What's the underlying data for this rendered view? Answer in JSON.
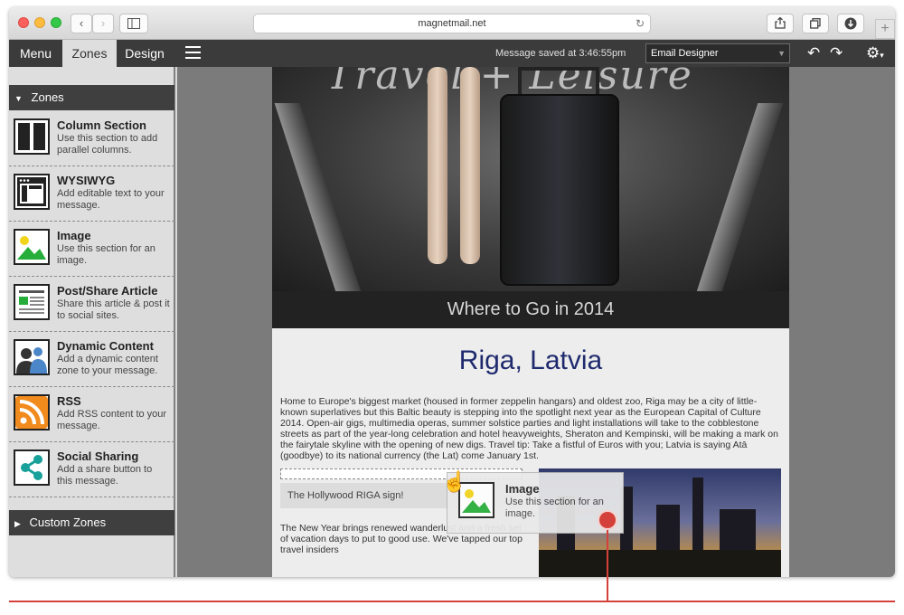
{
  "browser": {
    "url": "magnetmail.net",
    "nav_back": "‹",
    "nav_forward": "›",
    "new_tab": "+"
  },
  "toolbar": {
    "tabs": [
      {
        "label": "Menu",
        "active": false
      },
      {
        "label": "Zones",
        "active": true
      },
      {
        "label": "Design",
        "active": false
      }
    ],
    "save_status": "Message saved at 3:46:55pm",
    "mode_select": "Email Designer"
  },
  "sidebar": {
    "zones_header": "Zones",
    "custom_zones_header": "Custom Zones",
    "items": [
      {
        "title": "Column Section",
        "desc": "Use this section to add parallel columns.",
        "icon": "columns-icon"
      },
      {
        "title": "WYSIWYG",
        "desc": "Add editable text to your message.",
        "icon": "wysiwyg-icon"
      },
      {
        "title": "Image",
        "desc": "Use this section for an image.",
        "icon": "image-icon"
      },
      {
        "title": "Post/Share Article",
        "desc": "Share this article & post it to social sites.",
        "icon": "article-icon"
      },
      {
        "title": "Dynamic Content",
        "desc": "Add a dynamic content zone to your message.",
        "icon": "dynamic-content-icon"
      },
      {
        "title": "RSS",
        "desc": "Add RSS content to your message.",
        "icon": "rss-icon"
      },
      {
        "title": "Social Sharing",
        "desc": "Add a share button to this message.",
        "icon": "share-icon"
      }
    ]
  },
  "email": {
    "hero_title": "Travel + Leisure",
    "hero_caption": "Where to Go in 2014",
    "heading": "Riga, Latvia",
    "body": "Home to Europe's biggest market (housed in former zeppelin hangars) and oldest zoo, Riga may be a city of little-known superlatives but this Baltic beauty is stepping into the spotlight next year as the European Capital of Culture 2014. Open-air gigs, multimedia operas, summer solstice parties and light installations will take to the cobblestone streets as part of the year-long celebration and hotel heavyweights, Sheraton and Kempinski, will be making a mark on the fairytale skyline with the opening of new digs. Travel tip: Take a fistful of Euros with you; Latvia is saying Atā (goodbye) to its national currency (the Lat) come January 1st.",
    "image_caption": "The Hollywood RIGA sign!",
    "body2": "The New Year brings renewed wanderlust and a fresh set of vacation days to put to good use. We've tapped our top travel insiders"
  },
  "drag_ghost": {
    "title": "Image",
    "desc": "Use this section for an image."
  },
  "colors": {
    "toolbar_bg": "#3b3b3b",
    "heading": "#1f2a6e",
    "annotation": "#d4403a"
  }
}
